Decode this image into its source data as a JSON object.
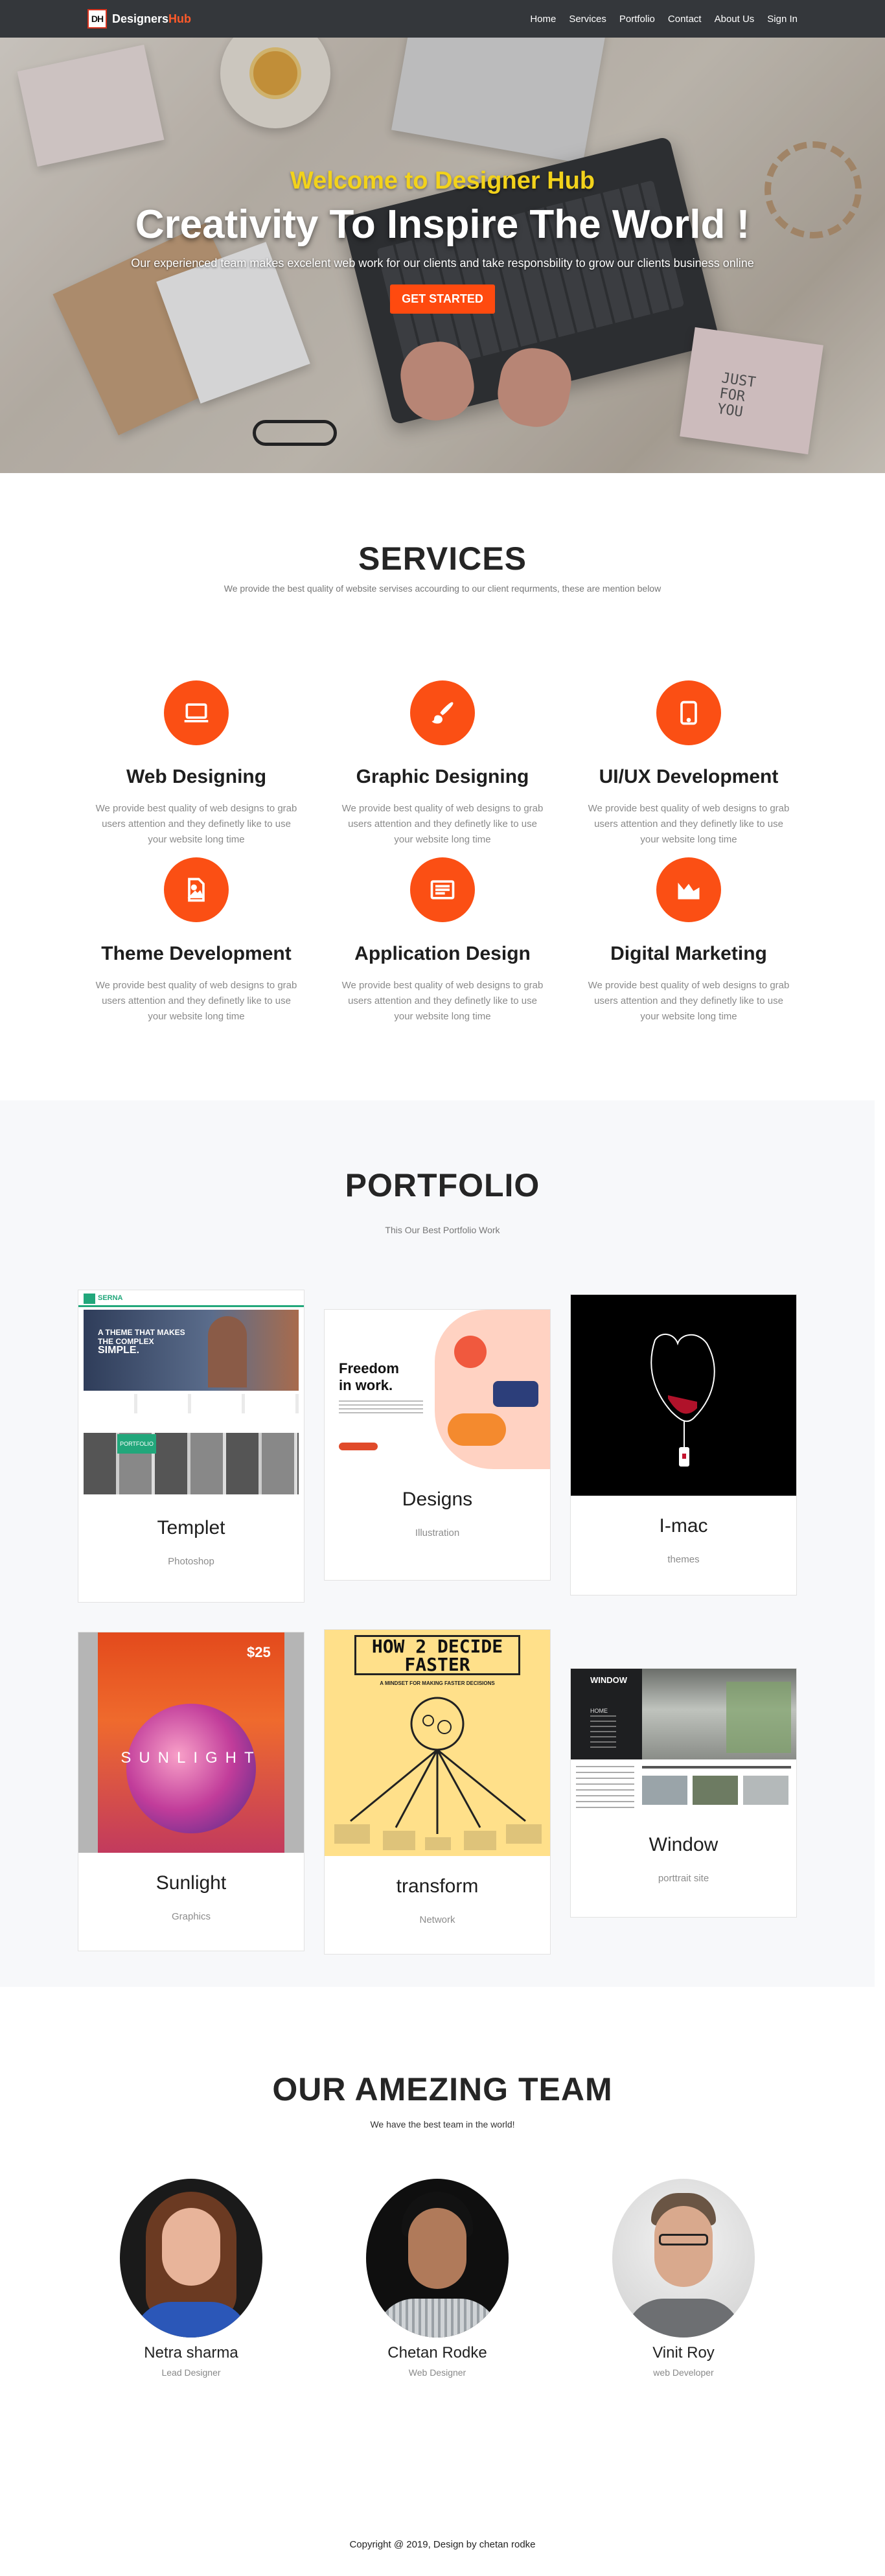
{
  "nav": {
    "brand_logo": "DH",
    "brand_part1": "Designers",
    "brand_part2": "Hub",
    "links": [
      "Home",
      "Services",
      "Portfolio",
      "Contact",
      "About Us",
      "Sign In"
    ]
  },
  "hero": {
    "welcome": "Welcome to Designer Hub",
    "title": "Creativity To Inspire The World !",
    "subtitle": "Our experienced team makes excelent web work for our clients and take responsbility to grow our clients business online",
    "cta": "GET STARTED",
    "sticky_note": "JUST FOR YOU"
  },
  "services": {
    "title": "SERVICES",
    "subtitle": "We provide the best quality of website servises accourding to our client requrments, these are mention below",
    "items": [
      {
        "name": "Web Designing",
        "desc": "We provide best quality of web designs to grab users attention and they definetly like to use your website long time",
        "icon": "laptop-icon"
      },
      {
        "name": "Graphic Designing",
        "desc": "We provide best quality of web designs to grab users attention and they definetly like to use your website long time",
        "icon": "paint-brush-icon"
      },
      {
        "name": "UI/UX Development",
        "desc": "We provide best quality of web designs to grab users attention and they definetly like to use your website long time",
        "icon": "tablet-icon"
      },
      {
        "name": "Theme Development",
        "desc": "We provide best quality of web designs to grab users attention and they definetly like to use your website long time",
        "icon": "image-file-icon"
      },
      {
        "name": "Application Design",
        "desc": "We provide best quality of web designs to grab users attention and they definetly like to use your website long time",
        "icon": "newspaper-icon"
      },
      {
        "name": "Digital Marketing",
        "desc": "We provide best quality of web designs to grab users attention and they definetly like to use your website long time",
        "icon": "area-chart-icon"
      }
    ]
  },
  "portfolio": {
    "title": "PORTFOLIO",
    "subtitle": "This Our Best Portfolio Work",
    "items": [
      {
        "title": "Templet",
        "category": "Photoshop",
        "img_text": [
          "SERNA",
          "A THEME THAT MAKES",
          "THE COMPLEX",
          "SIMPLE.",
          "PORTFOLIO"
        ]
      },
      {
        "title": "Designs",
        "category": "Illustration",
        "img_text": [
          "Freedom",
          "in work."
        ]
      },
      {
        "title": "I-mac",
        "category": "themes",
        "img_text": []
      },
      {
        "title": "Sunlight",
        "category": "Graphics",
        "img_text": [
          "$25",
          "SUNLIGHT"
        ]
      },
      {
        "title": "transform",
        "category": "Network",
        "img_text": [
          "HOW 2 DECIDE",
          "FASTER",
          "A MINDSET FOR MAKING FASTER DECISIONS"
        ]
      },
      {
        "title": "Window",
        "category": "porttrait site",
        "img_text": [
          "WINDOW",
          "HOME"
        ]
      }
    ]
  },
  "team": {
    "title": "OUR AMEZING TEAM",
    "subtitle": "We have the best team in the world!",
    "members": [
      {
        "name": "Netra sharma",
        "role": "Lead Designer"
      },
      {
        "name": "Chetan Rodke",
        "role": "Web Designer"
      },
      {
        "name": "Vinit Roy",
        "role": "web Developer"
      }
    ]
  },
  "footer": {
    "text": "Copyright @ 2019, Design by chetan rodke"
  },
  "colors": {
    "accent": "#fb4f14",
    "nav_bg": "#34373b",
    "hero_welcome": "#f2d21b"
  }
}
